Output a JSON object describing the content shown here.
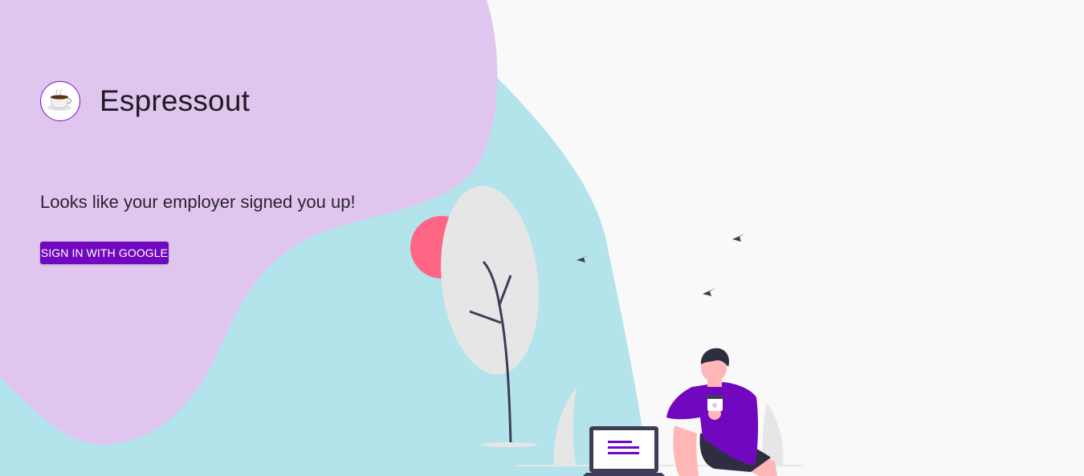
{
  "app": {
    "name": "Espressout",
    "logo_icon": "coffee-cup-icon"
  },
  "main": {
    "headline": "Looks like your employer signed you up!",
    "signin_label": "SIGN IN WITH GOOGLE"
  },
  "colors": {
    "accent": "#7108c0",
    "blob_lavender": "#e0c5ef",
    "blob_teal": "#b3e4ec",
    "sun": "#ff6584",
    "background": "#f9f9f9"
  }
}
